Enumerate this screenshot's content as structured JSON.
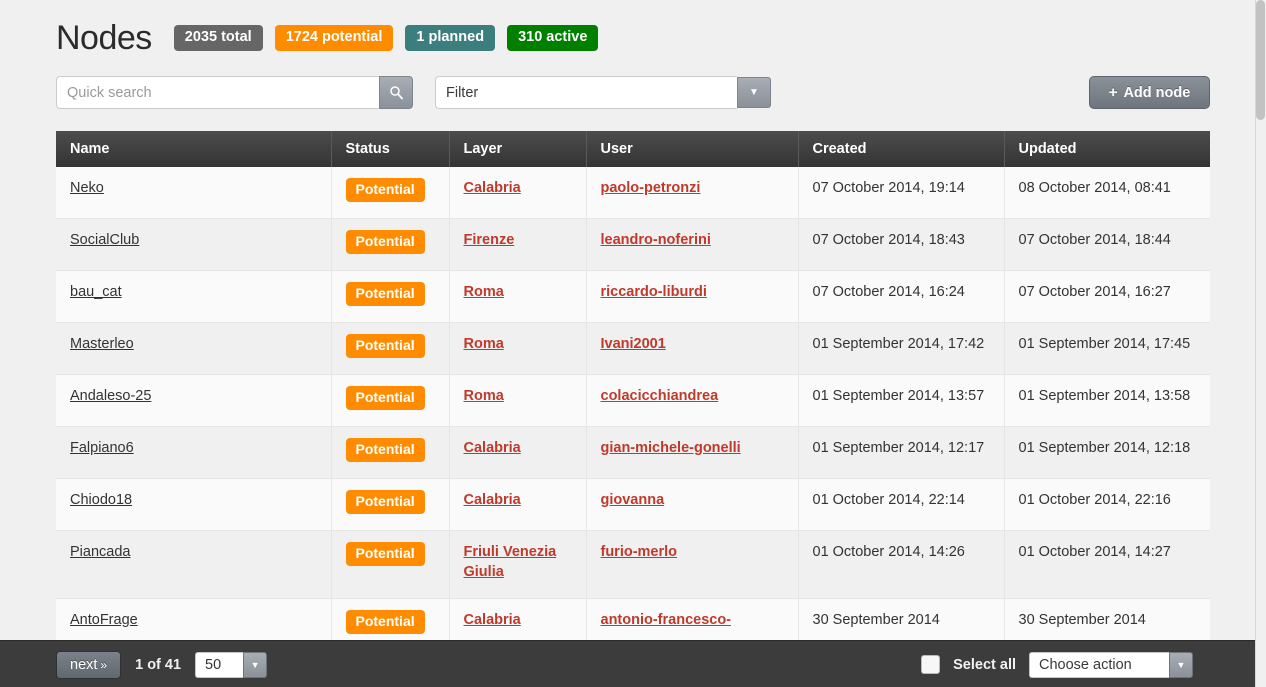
{
  "header": {
    "title": "Nodes",
    "badges": [
      {
        "label": "2035 total",
        "color": "#666666",
        "name": "badge-total"
      },
      {
        "label": "1724 potential",
        "color": "#ff8c00",
        "name": "badge-potential"
      },
      {
        "label": "1 planned",
        "color": "#3c7d7d",
        "name": "badge-planned"
      },
      {
        "label": "310 active",
        "color": "#018000",
        "name": "badge-active"
      }
    ]
  },
  "toolbar": {
    "search_placeholder": "Quick search",
    "search_value": "",
    "search_icon": "search-icon",
    "filter_value": "Filter",
    "filter_arrow": "▼",
    "add_node_label": "Add node",
    "add_node_plus": "+"
  },
  "table": {
    "columns": [
      "Name",
      "Status",
      "Layer",
      "User",
      "Created",
      "Updated"
    ],
    "rows": [
      {
        "name": "Neko",
        "status": "Potential",
        "layer": "Calabria",
        "user": "paolo-petronzi",
        "created": "07 October 2014, 19:14",
        "updated": "08 October 2014, 08:41"
      },
      {
        "name": "SocialClub",
        "status": "Potential",
        "layer": "Firenze",
        "user": "leandro-noferini",
        "created": "07 October 2014, 18:43",
        "updated": "07 October 2014, 18:44"
      },
      {
        "name": "bau_cat",
        "status": "Potential",
        "layer": "Roma",
        "user": "riccardo-liburdi",
        "created": "07 October 2014, 16:24",
        "updated": "07 October 2014, 16:27"
      },
      {
        "name": "Masterleo",
        "status": "Potential",
        "layer": "Roma",
        "user": "Ivani2001",
        "created": "01 September 2014, 17:42",
        "updated": "01 September 2014, 17:45"
      },
      {
        "name": "Andaleso-25",
        "status": "Potential",
        "layer": "Roma",
        "user": "colacicchiandrea",
        "created": "01 September 2014, 13:57",
        "updated": "01 September 2014, 13:58"
      },
      {
        "name": "Falpiano6",
        "status": "Potential",
        "layer": "Calabria",
        "user": "gian-michele-gonelli",
        "created": "01 September 2014, 12:17",
        "updated": "01 September 2014, 12:18"
      },
      {
        "name": "Chiodo18",
        "status": "Potential",
        "layer": "Calabria",
        "user": "giovanna",
        "created": "01 October 2014, 22:14",
        "updated": "01 October 2014, 22:16"
      },
      {
        "name": "Piancada",
        "status": "Potential",
        "layer": "Friuli Venezia Giulia",
        "user": "furio-merlo",
        "created": "01 October 2014, 14:26",
        "updated": "01 October 2014, 14:27"
      },
      {
        "name": "AntoFrage",
        "status": "Potential",
        "layer": "Calabria",
        "user": "antonio-francesco-",
        "created": "30 September 2014",
        "updated": "30 September 2014"
      }
    ]
  },
  "bottom": {
    "next_label": "next",
    "next_chevron": "»",
    "page_indicator": "1 of 41",
    "per_page_value": "50",
    "per_page_arrow": "▼",
    "select_all_label": "Select all",
    "action_value": "Choose action",
    "action_arrow": "▼"
  }
}
